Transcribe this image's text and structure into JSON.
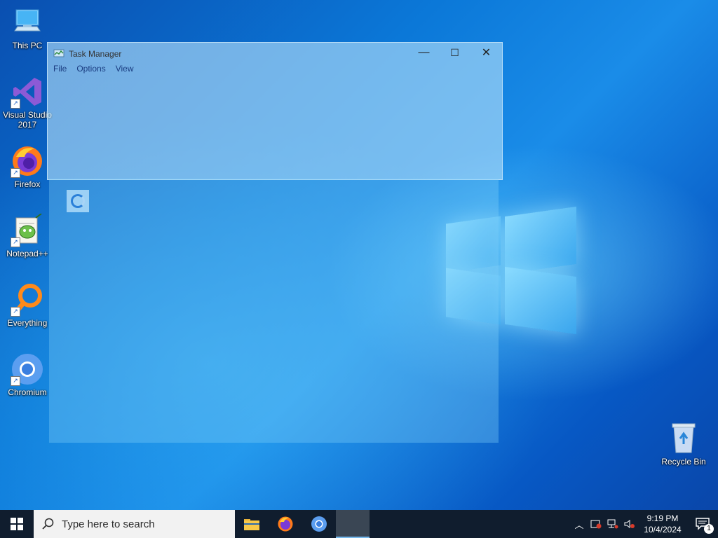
{
  "desktop": {
    "icons": [
      {
        "label": "This PC"
      },
      {
        "label": "Visual Studio 2017"
      },
      {
        "label": "Firefox"
      },
      {
        "label": "Notepad++"
      },
      {
        "label": "Everything"
      },
      {
        "label": "Chromium"
      },
      {
        "label": "Recycle Bin"
      }
    ]
  },
  "task_manager": {
    "title": "Task Manager",
    "menu": [
      "File",
      "Options",
      "View"
    ],
    "controls": {
      "minimize": "—",
      "maximize": "☐",
      "close": "✕"
    }
  },
  "taskbar": {
    "search_placeholder": "Type here to search",
    "apps": [
      "file-explorer",
      "firefox",
      "chromium",
      "task-manager"
    ],
    "clock_time": "9:19 PM",
    "clock_date": "10/4/2024",
    "notification_count": "1"
  },
  "colors": {
    "taskbar": "#101d2e",
    "accent": "#76b9ed"
  }
}
